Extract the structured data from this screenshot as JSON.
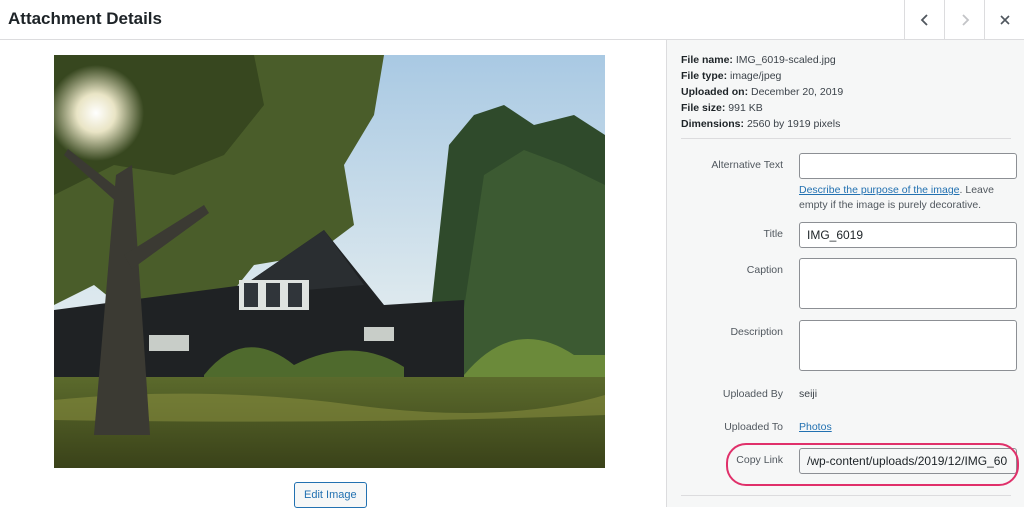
{
  "header": {
    "title": "Attachment Details"
  },
  "media": {
    "edit_image_label": "Edit Image"
  },
  "details": {
    "file_name_label": "File name:",
    "file_name": "IMG_6019-scaled.jpg",
    "file_type_label": "File type:",
    "file_type": "image/jpeg",
    "uploaded_on_label": "Uploaded on:",
    "uploaded_on": "December 20, 2019",
    "file_size_label": "File size:",
    "file_size": "991 KB",
    "dimensions_label": "Dimensions:",
    "dimensions": "2560 by 1919 pixels"
  },
  "form": {
    "alt_text_label": "Alternative Text",
    "alt_text_value": "",
    "alt_help_link": "Describe the purpose of the image",
    "alt_help_text": ". Leave empty if the image is purely decorative.",
    "title_label": "Title",
    "title_value": "IMG_6019",
    "caption_label": "Caption",
    "caption_value": "",
    "description_label": "Description",
    "description_value": "",
    "uploaded_by_label": "Uploaded By",
    "uploaded_by_value": "seiji",
    "uploaded_to_label": "Uploaded To",
    "uploaded_to_value": "Photos",
    "copy_link_label": "Copy Link",
    "copy_link_value": "/wp-content/uploads/2019/12/IMG_60"
  },
  "colors": {
    "accent": "#2271b1",
    "highlight": "#e0306a"
  }
}
